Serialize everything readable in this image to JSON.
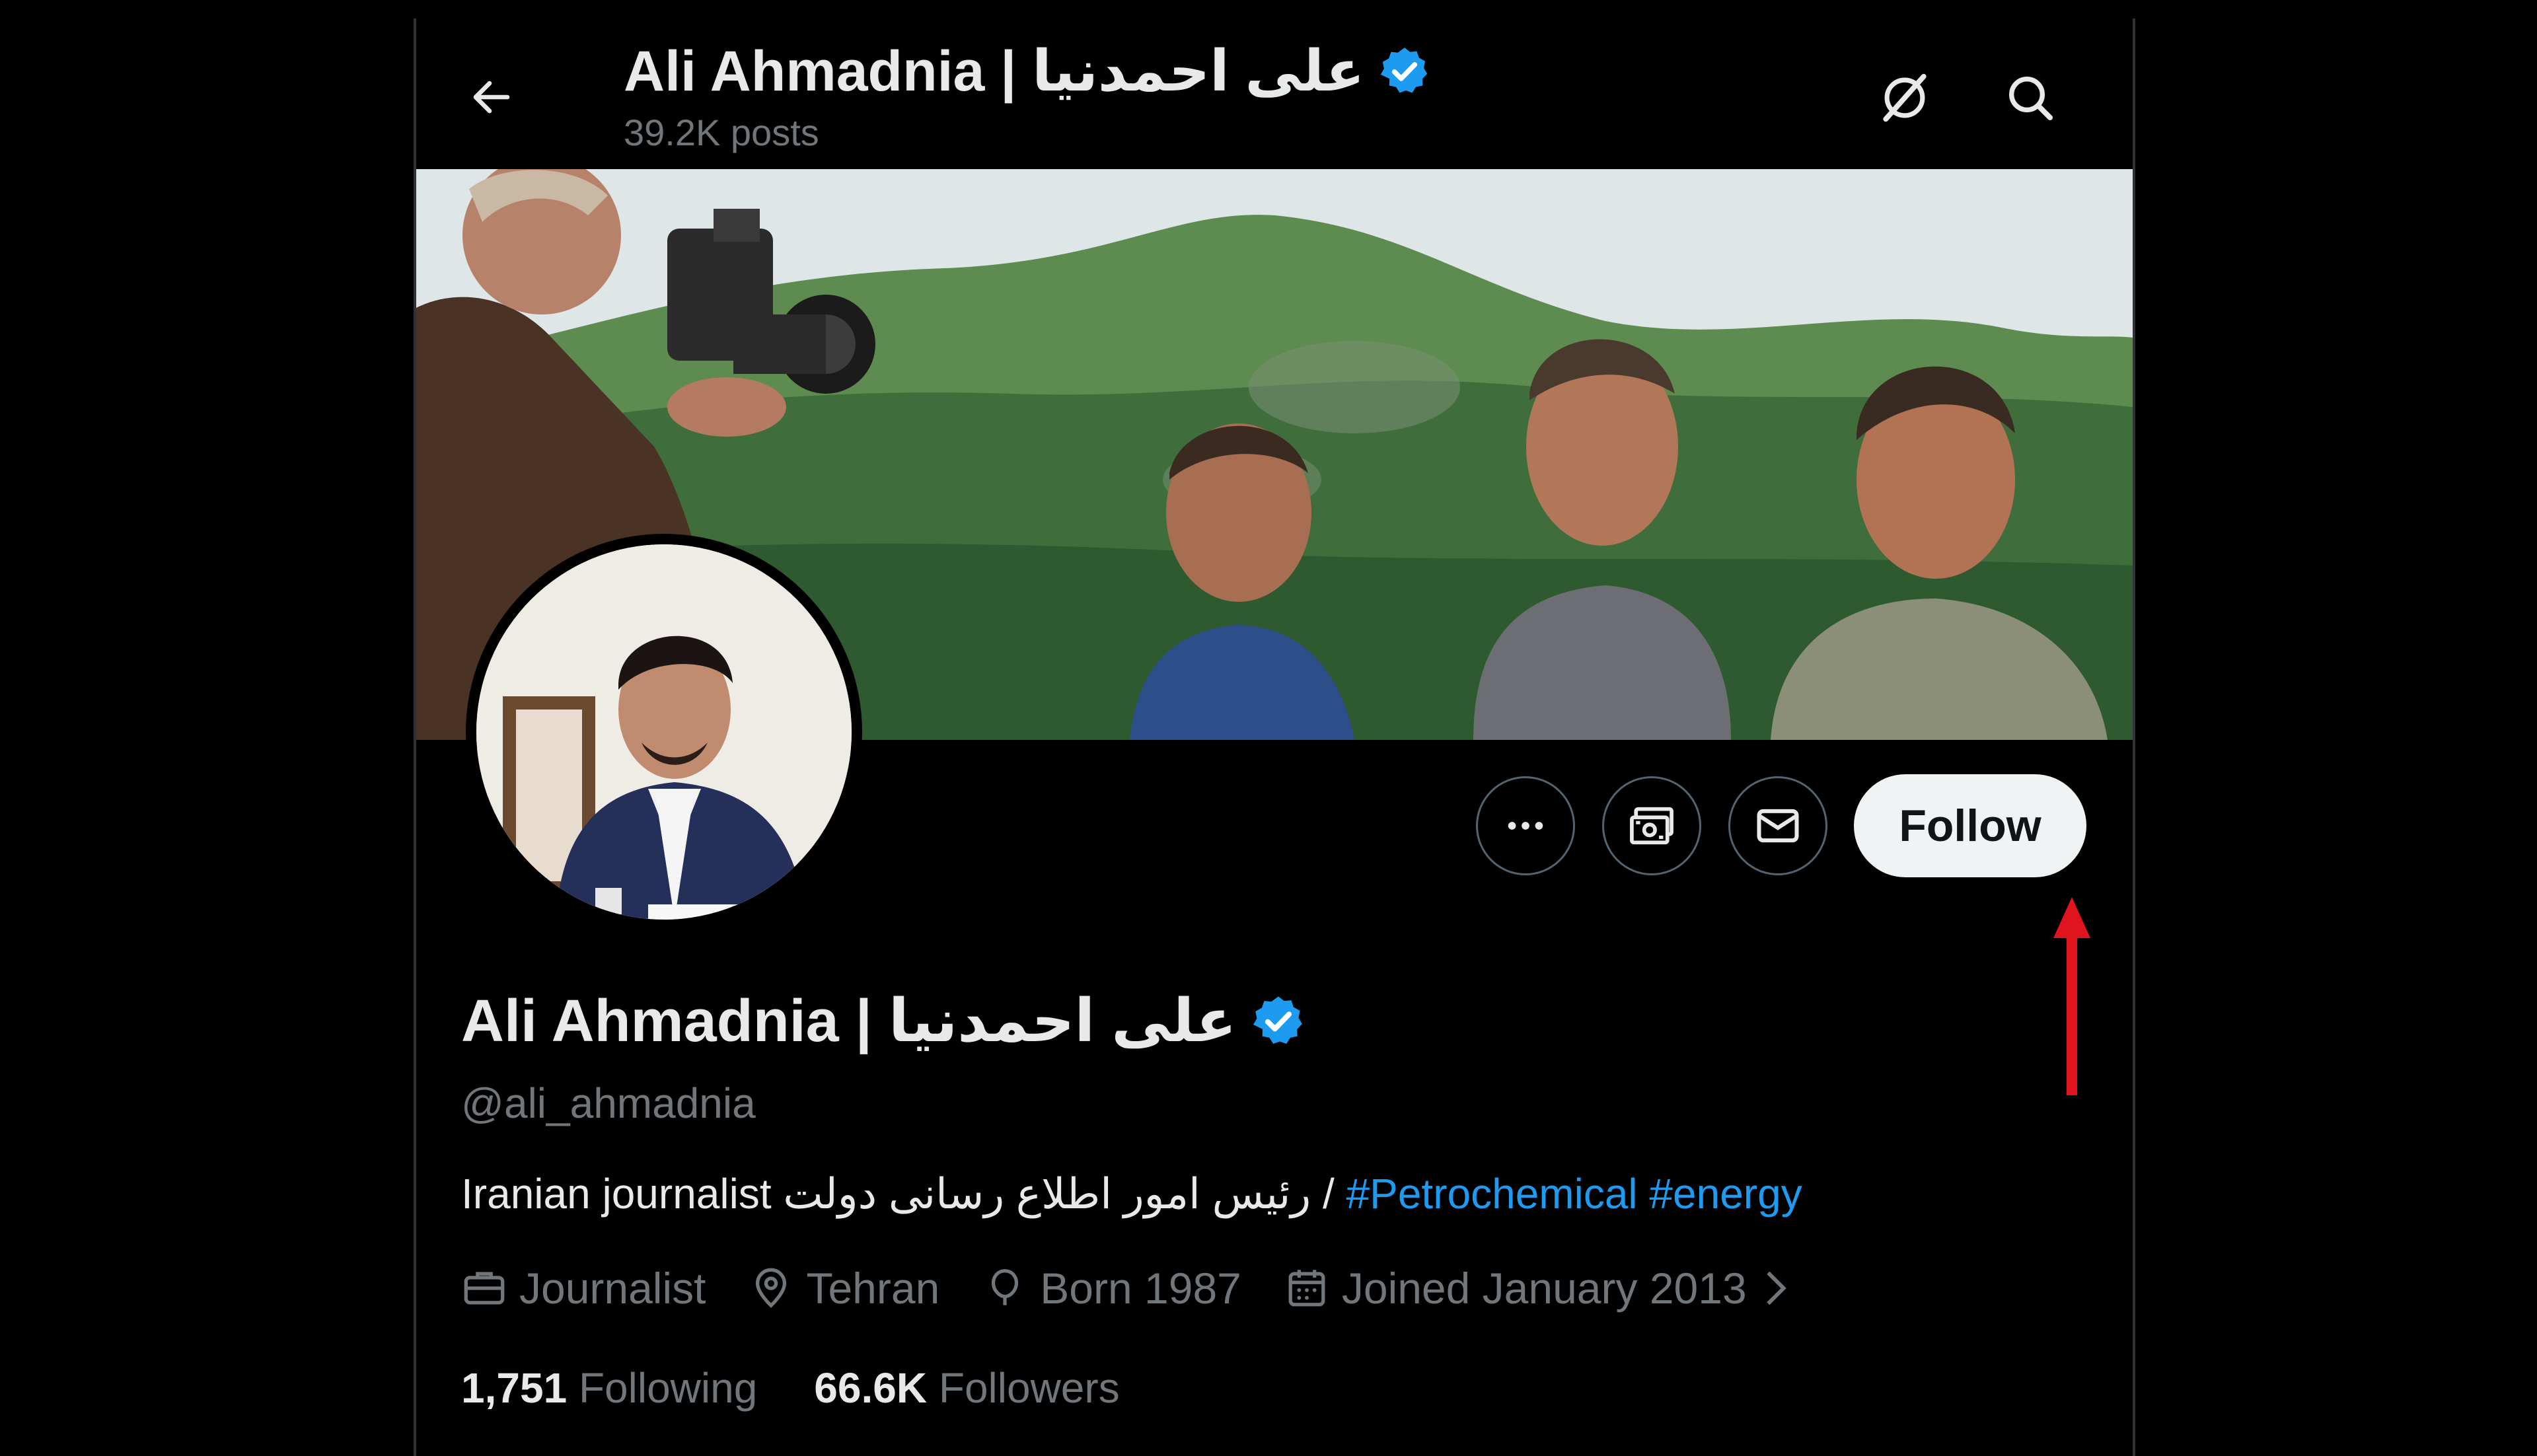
{
  "header": {
    "title": "Ali Ahmadnia | علی احمدنیا",
    "posts_count": "39.2K posts",
    "back_icon": "arrow-left-icon",
    "grok_icon": "grok-icon",
    "search_icon": "search-icon"
  },
  "banner": {
    "description_icon": "profile-banner-image"
  },
  "actions": {
    "more_icon": "more-horizontal-icon",
    "subscribe_icon": "money-subscribe-icon",
    "message_icon": "envelope-icon",
    "follow_label": "Follow"
  },
  "profile": {
    "display_name": "Ali Ahmadnia | علی احمدنیا",
    "handle": "@ali_ahmadnia",
    "bio_text": "Iranian journalist رئیس امور اطلاع رسانی دولت / ",
    "bio_tags": [
      "#Petrochemical",
      "#energy"
    ],
    "meta": {
      "profession": "Journalist",
      "location": "Tehran",
      "birth": "Born 1987",
      "joined": "Joined January 2013"
    },
    "following_count": "1,751",
    "following_label": "Following",
    "followers_count": "66.6K",
    "followers_label": "Followers"
  },
  "colors": {
    "accent": "#1d9bf0",
    "verified": "#1d9bf0",
    "annotation_arrow": "#e0141e",
    "muted_text": "#71767b"
  }
}
